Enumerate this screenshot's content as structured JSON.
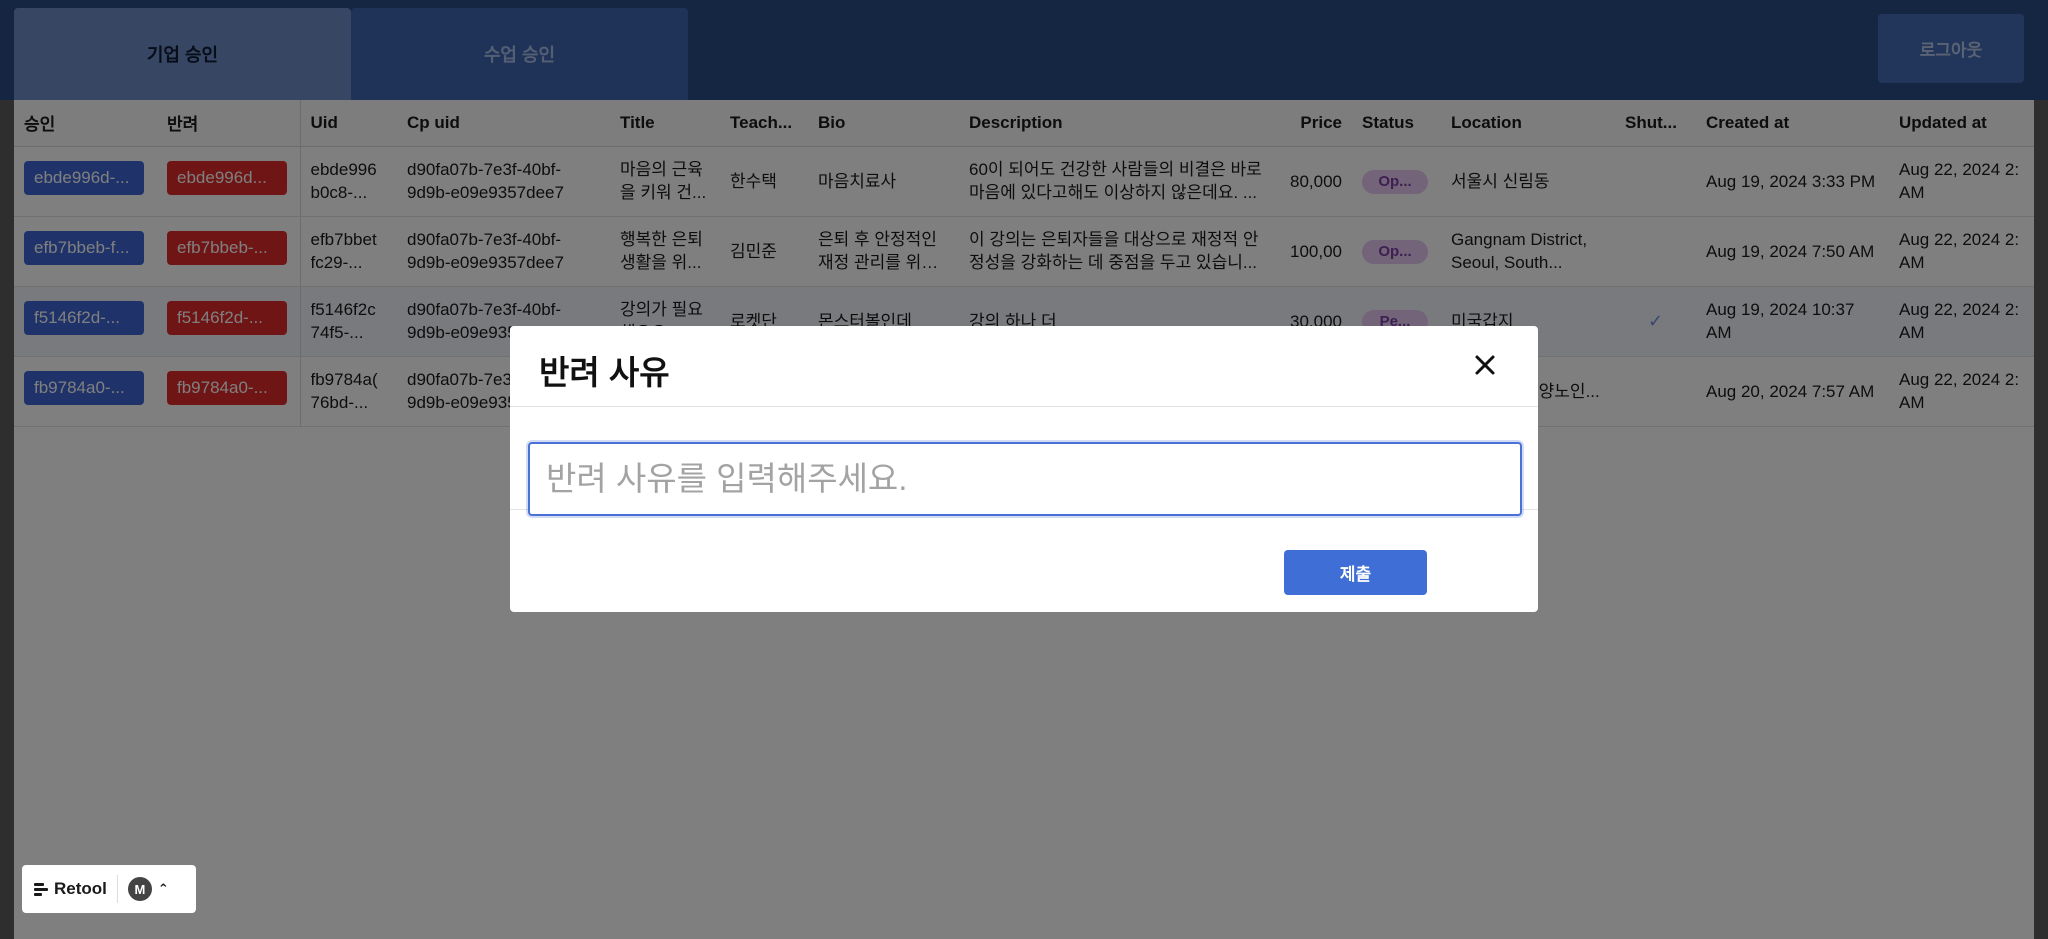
{
  "tabs": [
    {
      "label": "기업 승인",
      "active": true
    },
    {
      "label": "수업 승인",
      "active": false
    }
  ],
  "logout_label": "로그아웃",
  "table": {
    "columns": [
      "승인",
      "반려",
      "Uid",
      "Cp uid",
      "Title",
      "Teach...",
      "Bio",
      "Description",
      "Price",
      "Status",
      "Location",
      "Shut...",
      "Created at",
      "Updated at"
    ],
    "rows": [
      {
        "approve": "ebde996d-...",
        "reject": "ebde996d...",
        "uid": "ebde996 b0c8-...",
        "cp_uid": "d90fa07b-7e3f-40bf-9d9b-e09e9357dee7",
        "title": "마음의 근육을 키워 건...",
        "teacher": "한수택",
        "bio": "마음치료사",
        "description": "60이 되어도 건강한 사람들의 비결은 바로 마음에 있다고해도 이상하지 않은데요. ...",
        "price": "80,000",
        "status": "Op...",
        "location": "서울시 신림동",
        "shut": "",
        "created": "Aug 19, 2024 3:33 PM",
        "updated": "Aug 22, 2024 2: AM"
      },
      {
        "approve": "efb7bbeb-f...",
        "reject": "efb7bbeb-...",
        "uid": "efb7bbet fc29-...",
        "cp_uid": "d90fa07b-7e3f-40bf-9d9b-e09e9357dee7",
        "title": "행복한 은퇴생활을 위...",
        "teacher": "김민준",
        "bio": "은퇴 후 안정적인 재정 관리를 위해...",
        "description": "이 강의는 은퇴자들을 대상으로 재정적 안정성을 강화하는 데 중점을 두고 있습니...",
        "price": "100,00",
        "status": "Op...",
        "location": "Gangnam District, Seoul, South...",
        "shut": "",
        "created": "Aug 19, 2024 7:50 AM",
        "updated": "Aug 22, 2024 2: AM"
      },
      {
        "approve": "f5146f2d-...",
        "reject": "f5146f2d-...",
        "uid": "f5146f2c 74f5-...",
        "cp_uid": "d90fa07b-7e3f-40bf-9d9b-e09e9357dee7",
        "title": "강의가 필요 해요오",
        "teacher": "로켓단",
        "bio": "몬스터볼인데",
        "description": "강의 하나 더",
        "price": "30,000",
        "status": "Pe...",
        "location": "미국갑지",
        "shut": "✓",
        "created": "Aug 19, 2024 10:37 AM",
        "updated": "Aug 22, 2024 2: AM"
      },
      {
        "approve": "fb9784a0-...",
        "reject": "fb9784a0-...",
        "uid": "fb9784a( 76bd-...",
        "cp_uid": "d90fa07b-7e3f-40bf-9d9b-e09e9357dee7",
        "title": "",
        "teacher": "",
        "bio": "",
        "description": "",
        "price": "",
        "status": "",
        "location": "덕양구 어 덕양노인...",
        "shut": "",
        "created": "Aug 20, 2024 7:57 AM",
        "updated": "Aug 22, 2024 2: AM"
      }
    ]
  },
  "modal": {
    "title": "반려 사유",
    "input_placeholder": "반려 사유를 입력해주세요.",
    "input_value": "",
    "submit_label": "제출"
  },
  "retool_badge": {
    "label": "Retool",
    "avatar_initial": "M"
  },
  "colors": {
    "approve": "#3f67d4",
    "reject": "#e02b2b",
    "status_pill": "#e6c9f3",
    "focus": "#4a72d6"
  }
}
